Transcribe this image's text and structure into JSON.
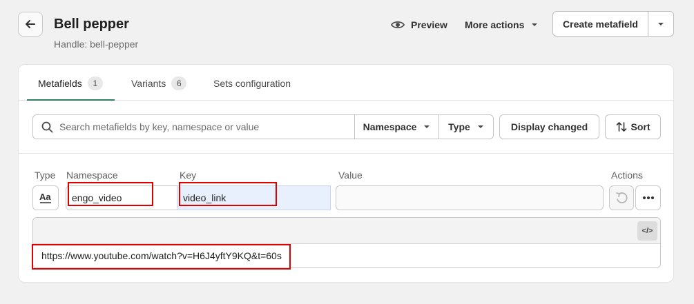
{
  "header": {
    "title": "Bell pepper",
    "subtitle": "Handle: bell-pepper",
    "preview_label": "Preview",
    "more_actions_label": "More actions",
    "create_label": "Create metafield"
  },
  "tabs": [
    {
      "label": "Metafields",
      "count": "1"
    },
    {
      "label": "Variants",
      "count": "6"
    },
    {
      "label": "Sets configuration"
    }
  ],
  "filters": {
    "search_placeholder": "Search metafields by key, namespace or value",
    "namespace_label": "Namespace",
    "type_label": "Type",
    "display_changed_label": "Display changed",
    "sort_label": "Sort"
  },
  "table": {
    "headers": {
      "type": "Type",
      "namespace": "Namespace",
      "key": "Key",
      "value": "Value",
      "actions": "Actions"
    },
    "row": {
      "namespace": "engo_video",
      "key": "video_link",
      "value": "",
      "rich_text_value": "https://www.youtube.com/watch?v=H6J4yftY9KQ&t=60s"
    },
    "code_toggle": "</>"
  },
  "colors": {
    "highlight": "#e00000",
    "tab_active": "#2f7d62",
    "key_field_bg": "#e8f0fd"
  }
}
